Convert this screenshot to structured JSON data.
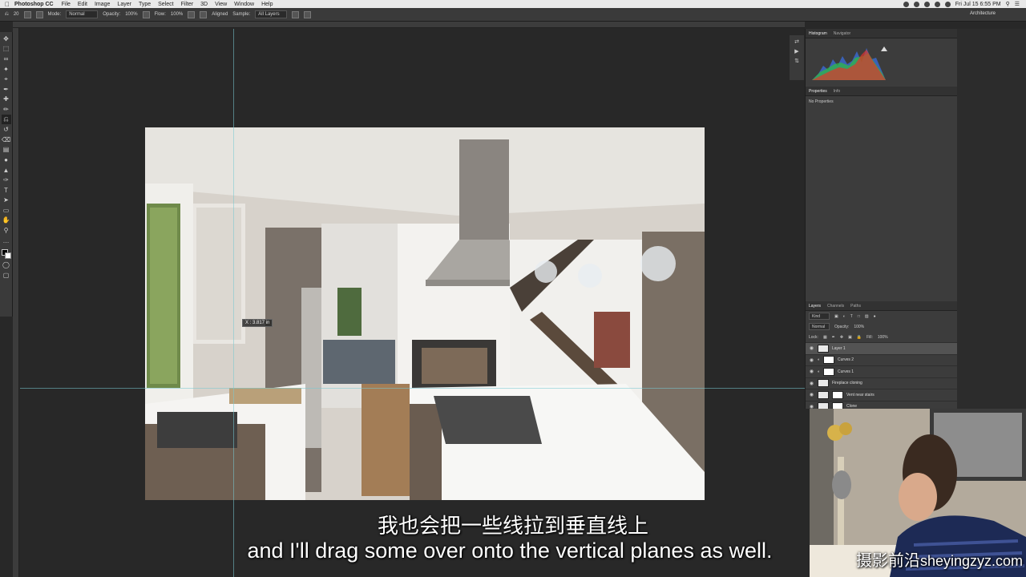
{
  "menubar": {
    "app_name": "Photoshop CC",
    "items": [
      "File",
      "Edit",
      "Image",
      "Layer",
      "Type",
      "Select",
      "Filter",
      "3D",
      "View",
      "Window",
      "Help"
    ],
    "clock": "Fri Jul 15  6:55 PM"
  },
  "options": {
    "brush_size": "20",
    "mode_label": "Mode:",
    "mode_value": "Normal",
    "opacity_label": "Opacity:",
    "opacity_value": "100%",
    "flow_label": "Flow:",
    "flow_value": "100%",
    "aligned_label": "Aligned",
    "sample_label": "Sample:",
    "sample_value": "All Layers",
    "workspace": "Architecture"
  },
  "canvas": {
    "readout": "X : 3.817 in"
  },
  "panels": {
    "histogram_tab": "Histogram",
    "navigator_tab": "Navigator",
    "properties_tab": "Properties",
    "info_tab": "Info",
    "properties_empty": "No Properties",
    "layers_tab": "Layers",
    "channels_tab": "Channels",
    "paths_tab": "Paths",
    "filter_kind": "Kind",
    "blend_mode": "Normal",
    "opacity_label": "Opacity:",
    "opacity_value": "100%",
    "lock_label": "Lock:",
    "fill_label": "Fill:",
    "fill_value": "100%",
    "layers": [
      {
        "name": "Layer 1"
      },
      {
        "name": "Curves 2"
      },
      {
        "name": "Curves 1"
      },
      {
        "name": "Fireplace cloning"
      },
      {
        "name": "Vent near stairs"
      },
      {
        "name": "Clone"
      }
    ]
  },
  "subtitles": {
    "chinese": "我也会把一些线拉到垂直线上",
    "english": "and I'll drag some over onto the vertical planes as well."
  },
  "watermark": {
    "chinese": "摄影前沿",
    "latin": "sheyingzyz.com"
  },
  "colors": {
    "app_bg": "#282828",
    "panel_bg": "#3c3c3c",
    "guide": "#78c8d2",
    "selected_layer": "#535353"
  }
}
